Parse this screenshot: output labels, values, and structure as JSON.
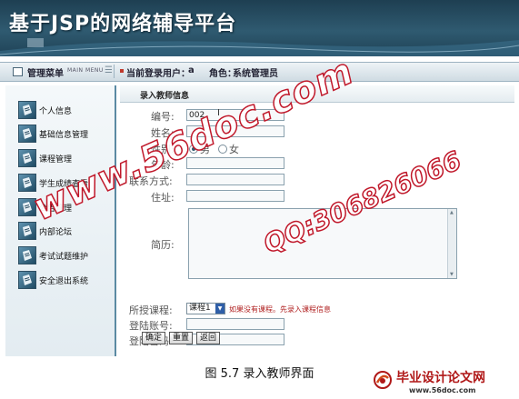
{
  "banner": {
    "title": "基于JSP的网络辅导平台"
  },
  "topbar": {
    "menu_title": "管理菜单",
    "menu_en": "MAIN MENU",
    "current_user_label": "当前登录用户：",
    "current_user_value": "a",
    "role_label": "角色：",
    "role_value": "系统管理员"
  },
  "sidebar": {
    "items": [
      {
        "label": "个人信息",
        "icon": "document-icon"
      },
      {
        "label": "基础信息管理",
        "icon": "document-icon"
      },
      {
        "label": "课程管理",
        "icon": "document-icon"
      },
      {
        "label": "学生成绩查看",
        "icon": "document-icon"
      },
      {
        "label": "公告管理",
        "icon": "document-icon"
      },
      {
        "label": "内部论坛",
        "icon": "document-icon"
      },
      {
        "label": "考试试题维护",
        "icon": "document-icon"
      },
      {
        "label": "安全退出系统",
        "icon": "document-icon"
      }
    ]
  },
  "form": {
    "section_title": "录入教师信息",
    "id_label": "编号:",
    "id_value": "002",
    "name_label": "姓名:",
    "name_value": "",
    "gender_label": "性别:",
    "gender_options": [
      "男",
      "女"
    ],
    "gender_selected": "男",
    "age_label": "年龄:",
    "age_value": "",
    "contact_label": "联系方式:",
    "contact_value": "",
    "address_label": "住址:",
    "address_value": "",
    "resume_label": "简历:",
    "resume_value": "",
    "course_label": "所授课程:",
    "course_selected": "课程1",
    "course_hint": "如果没有课程。先录入课程信息",
    "account_label": "登陆账号:",
    "account_value": "",
    "password_label": "登陆密码:",
    "password_value": "",
    "buttons": {
      "confirm": "确定",
      "reset": "重置",
      "back": "返回"
    }
  },
  "caption": "图 5.7 录入教师界面",
  "watermarks": {
    "site": "www.56doc.com",
    "qq": "QQ:306826066"
  },
  "footer_logo": {
    "name": "毕业设计论文网",
    "url": "www.56doc.com"
  },
  "colors": {
    "banner": "#2f5a70",
    "accent": "#5b8aa3",
    "hint": "#b02020",
    "watermark": "#c0182a"
  }
}
